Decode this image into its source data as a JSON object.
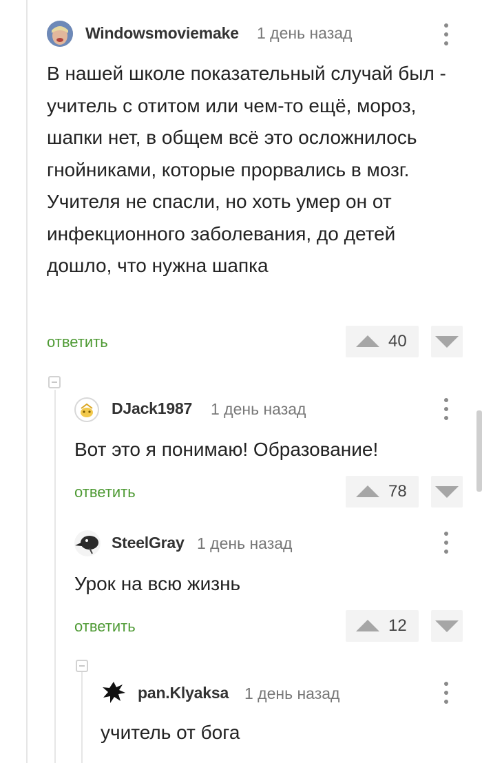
{
  "reply_label": "ответить",
  "comments": [
    {
      "author": "Windowsmoviemake",
      "time": "1 день назад",
      "text": "В нашей школе показательный случай был - учитель с отитом или чем-то ещё, мороз, шапки нет, в общем всё это осложнилось гнойниками, которые прорвались в мозг. Учителя не спасли, но хоть умер он от инфекционного заболевания, до детей дошло, что нужна шапка",
      "votes": "40"
    },
    {
      "author": "DJack1987",
      "time": "1 день назад",
      "text": "Вот это я понимаю! Образование!",
      "votes": "78"
    },
    {
      "author": "SteelGray",
      "time": "1 день назад",
      "text": "Урок на всю жизнь",
      "votes": "12"
    },
    {
      "author": "pan.Klyaksa",
      "time": "1 день назад",
      "text": "учитель от бога"
    }
  ],
  "colors": {
    "accent_green": "#4e9a34",
    "vote_bg": "#f3f3f3",
    "vote_arrow": "#a6a6a6"
  }
}
